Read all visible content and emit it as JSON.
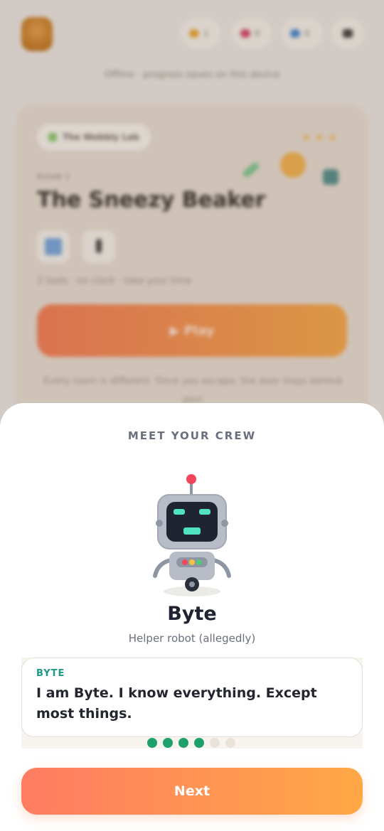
{
  "background": {
    "stats": [
      "1",
      "0",
      "0",
      ""
    ],
    "offline_note": "Offline · progress saves on this device",
    "lab_chip": "The Wobbly Lab",
    "room_label": "ROOM 1",
    "room_title": "The Sneezy Beaker",
    "hint": "2 tools · no clock · take your time",
    "play_label": "▶ Play",
    "blurb": "Every room is different. Once you escape, the door stays behind you!"
  },
  "sheet": {
    "heading": "MEET YOUR CREW",
    "character": {
      "name": "Byte",
      "role": "Helper robot (allegedly)",
      "icon": "robot-icon"
    },
    "bubble": {
      "speaker": "BYTE",
      "text": "I am Byte. I know everything. Except most things."
    },
    "progress": {
      "current": 4,
      "total": 6
    },
    "next_label": "Next"
  },
  "colors": {
    "accent_start": "#ff7c63",
    "accent_end": "#ffa845",
    "dot_active": "#1f9f6e",
    "speaker": "#1d9a86"
  }
}
